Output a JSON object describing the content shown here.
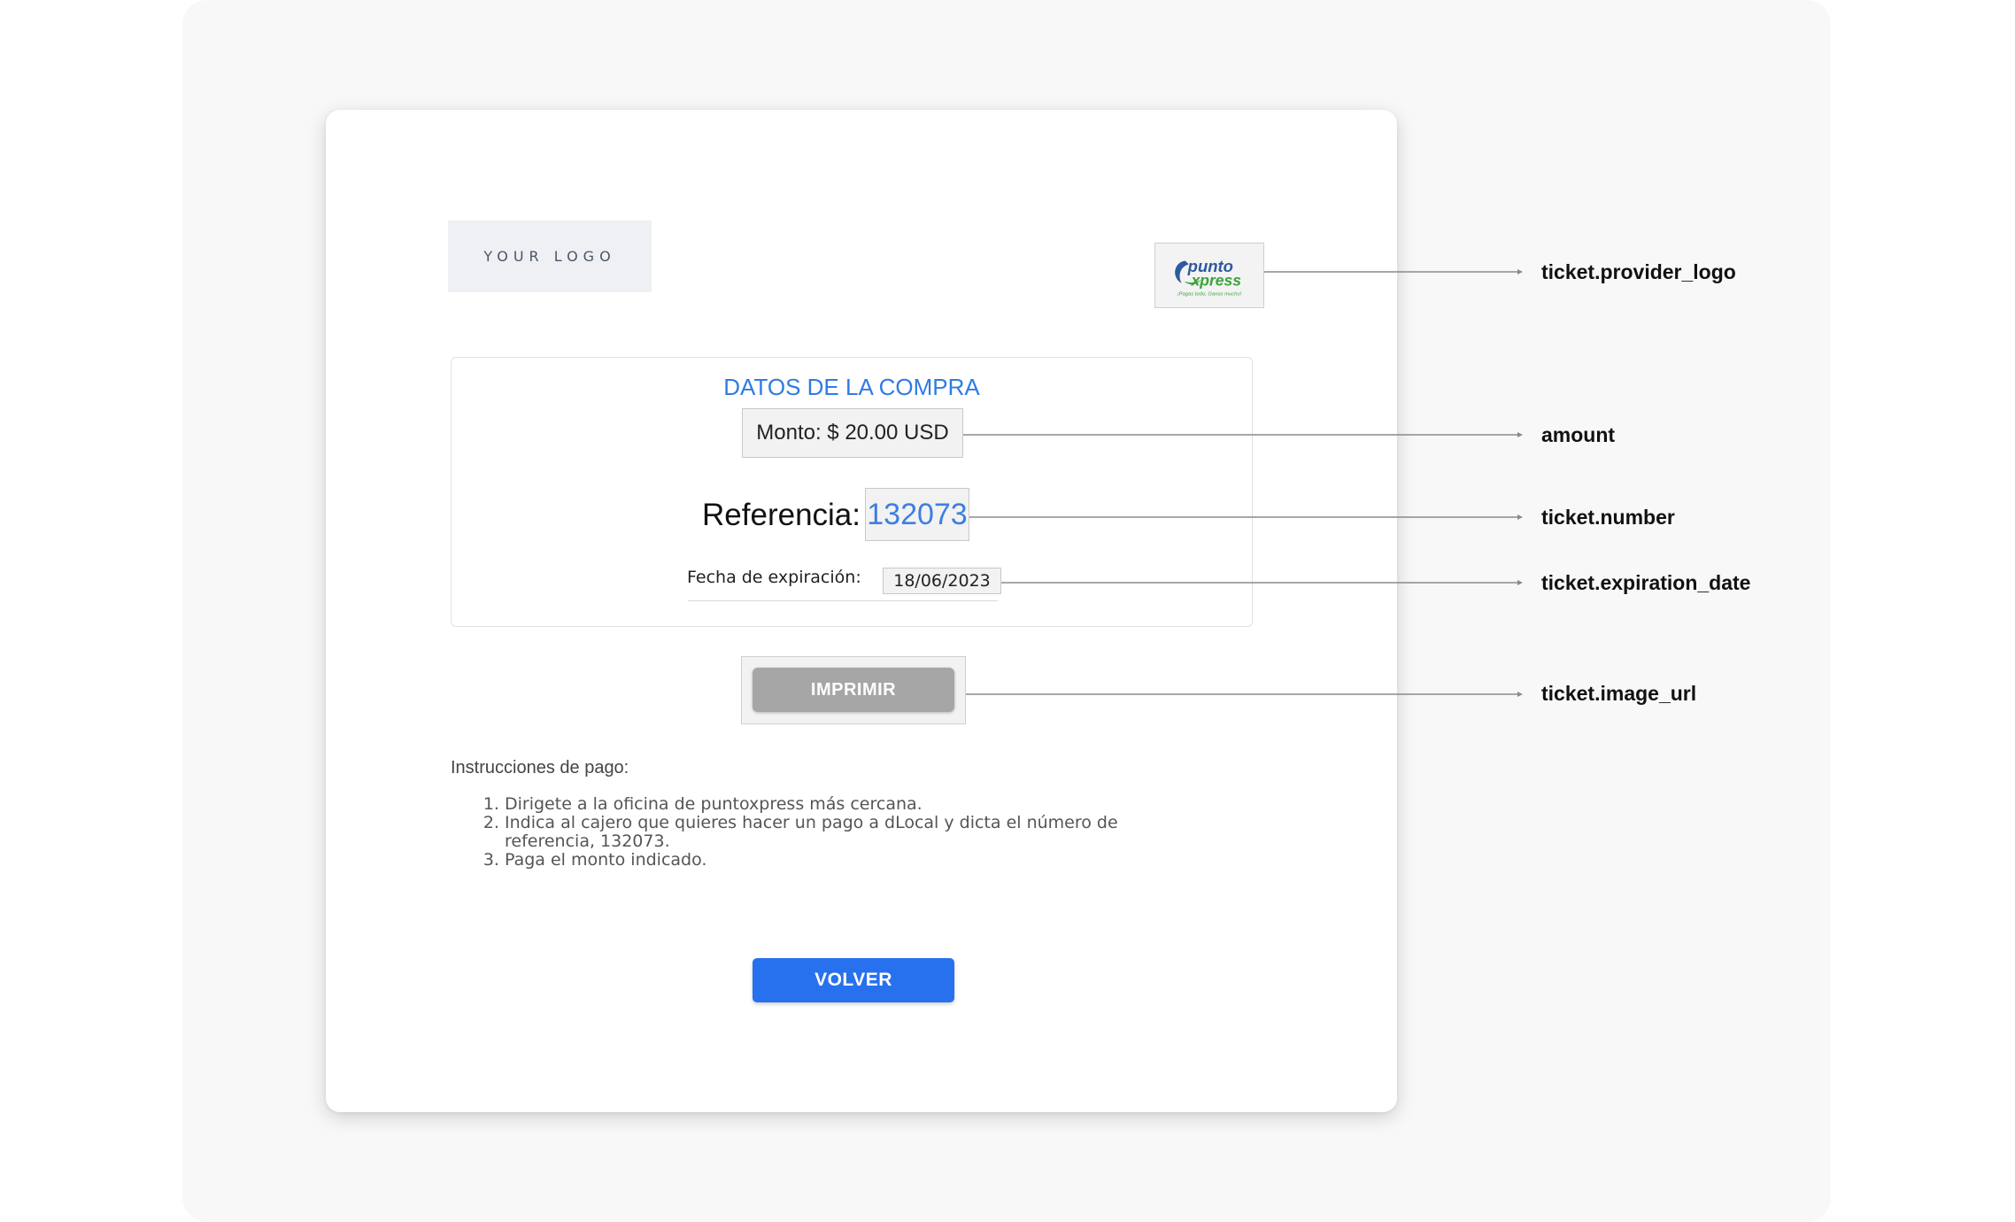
{
  "logo": {
    "placeholder_text": "YOUR LOGO"
  },
  "provider_logo": {
    "brand_top": "punto",
    "brand_bottom": "xpress",
    "tagline": "¡Pagas todo, Ganas mucho!",
    "colors": {
      "green": "#3aa33c",
      "blue": "#2c5aa0"
    }
  },
  "purchase": {
    "title": "DATOS DE LA COMPRA",
    "amount": "Monto: $ 20.00 USD",
    "reference_label": "Referencia:",
    "reference_number": "132073",
    "expiration_label": "Fecha de expiración:",
    "expiration_date": "18/06/2023"
  },
  "print_button": {
    "label": "IMPRIMIR"
  },
  "instructions": {
    "title": "Instrucciones de pago:",
    "steps": [
      "Dirigete a la oficina de puntoxpress más cercana.",
      "Indica al cajero que quieres hacer un pago a dLocal y dicta el número de referencia, 132073.",
      "Paga el monto indicado."
    ]
  },
  "back_button": {
    "label": "VOLVER"
  },
  "annotations": [
    {
      "label": "ticket.provider_logo"
    },
    {
      "label": "amount"
    },
    {
      "label": "ticket.number"
    },
    {
      "label": "ticket.expiration_date"
    },
    {
      "label": "ticket.image_url"
    }
  ],
  "colors": {
    "accent_blue": "#2f7be5",
    "button_blue": "#2871ee",
    "button_gray": "#a6a6a6"
  }
}
